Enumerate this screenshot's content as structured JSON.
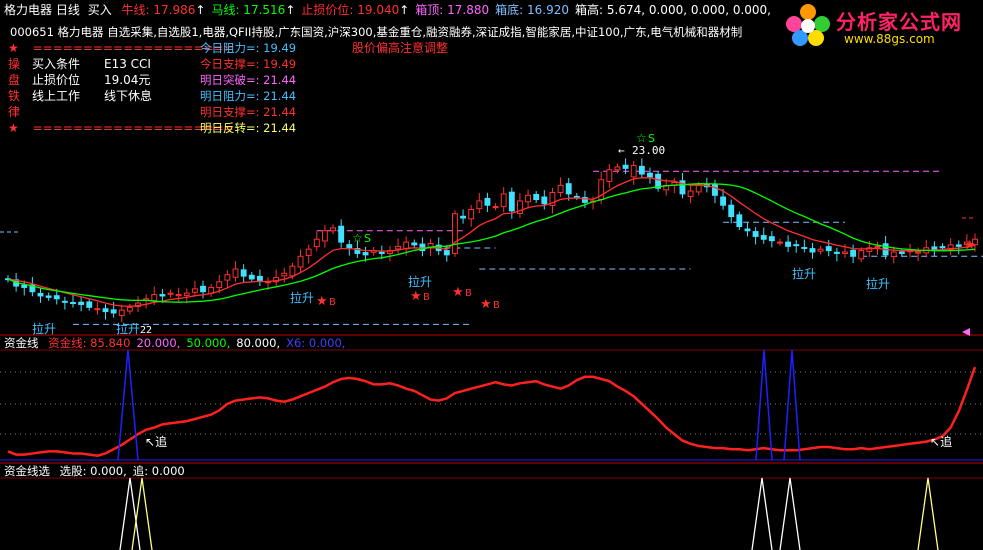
{
  "header": {
    "stock_name": "格力电器",
    "period": "日线",
    "buy_label": "买入",
    "items": [
      {
        "label": "牛线: 17.986",
        "color": "#ff3030"
      },
      {
        "label": "马线: 17.516",
        "color": "#00ff00"
      },
      {
        "label": "止损价位: 19.040",
        "color": "#ff3030"
      },
      {
        "label": "箱顶: 17.880",
        "color": "#ff66ff"
      },
      {
        "label": "箱底: 16.920",
        "color": "#80c0ff"
      },
      {
        "label": "箱高: 5.674, 0.000, 0.000, 0.000,",
        "color": "#ffffff"
      }
    ],
    "info_line": "000651 格力电器 自选采集,自选股1,电器,QFII持股,广东国资,沪深300,基金重仓,融资融券,深证成指,智能家居,中证100,广东,电气机械和器材制",
    "up_arrow": "↑"
  },
  "logo": {
    "title": "分析家公式网",
    "url": "www.88gs.com"
  },
  "rules_panel": {
    "star": "★",
    "separator": "====================",
    "side_chars": [
      "操",
      "盘",
      "铁",
      "律"
    ],
    "rows": [
      {
        "a": "买入条件",
        "b": "E13 CCI"
      },
      {
        "a": "止损价位",
        "b": "19.04元"
      },
      {
        "a": "线上工作",
        "b": "线下休息"
      }
    ]
  },
  "levels_panel": {
    "items": [
      {
        "label": "今日阻力=: 19.49",
        "color": "#40c0ff"
      },
      {
        "label": "今日支撑=: 19.49",
        "color": "#ff3030"
      },
      {
        "label": "明日突破=: 21.44",
        "color": "#ff66ff"
      },
      {
        "label": "明日阻力=: 21.44",
        "color": "#40c0ff"
      },
      {
        "label": "明日支撑=: 21.44",
        "color": "#ff3030"
      },
      {
        "label": "明日反转=: 21.44",
        "color": "#ffff66"
      }
    ]
  },
  "notice": "股价偏高注意调整",
  "annotations": {
    "peak_price": "23.00",
    "low_price": "22",
    "signal_s": "S",
    "signal_b": "B",
    "lift": "拉升",
    "chase": "追"
  },
  "money_panel": {
    "name": "资金线",
    "items": [
      {
        "label": "资金线: 85.840",
        "color": "#ff3030"
      },
      {
        "label": "20.000,",
        "color": "#ff66ff"
      },
      {
        "label": "50.000,",
        "color": "#00ff00"
      },
      {
        "label": "80.000,",
        "color": "#ffffff"
      },
      {
        "label": "X6: 0.000,",
        "color": "#4040ff"
      }
    ]
  },
  "select_panel": {
    "name": "资金线选",
    "items": [
      {
        "label": "选股: 0.000,",
        "color": "#ffffff"
      },
      {
        "label": "追: 0.000",
        "color": "#ffffff"
      }
    ]
  },
  "chart_data": {
    "type": "candlestick",
    "title": "格力电器 日线",
    "candles": {
      "count": 120,
      "close": [
        18.4,
        18.15,
        18.1,
        17.95,
        17.8,
        17.75,
        17.7,
        17.6,
        17.55,
        17.5,
        17.4,
        17.35,
        17.25,
        17.2,
        17.3,
        17.4,
        17.55,
        17.7,
        17.85,
        17.8,
        17.9,
        17.85,
        17.9,
        18.05,
        17.95,
        18.1,
        18.3,
        18.55,
        18.75,
        18.5,
        18.4,
        18.35,
        18.3,
        18.45,
        18.6,
        18.85,
        19.2,
        19.45,
        19.8,
        20.1,
        20.2,
        19.7,
        19.5,
        19.3,
        19.25,
        19.4,
        19.3,
        19.4,
        19.55,
        19.7,
        19.6,
        19.4,
        19.65,
        19.4,
        19.25,
        20.7,
        20.55,
        20.85,
        21.15,
        21.0,
        20.95,
        21.4,
        20.8,
        21.15,
        21.35,
        21.2,
        21.05,
        21.45,
        21.7,
        21.4,
        21.3,
        21.1,
        21.15,
        21.9,
        22.25,
        22.35,
        22.3,
        22.4,
        22.1,
        22.0,
        21.6,
        21.7,
        21.8,
        21.4,
        21.5,
        21.7,
        21.65,
        21.35,
        21.0,
        20.6,
        20.25,
        20.1,
        19.9,
        19.8,
        19.75,
        19.7,
        19.55,
        19.6,
        19.5,
        19.35,
        19.45,
        19.4,
        19.3,
        19.35,
        19.2,
        19.4,
        19.5,
        19.55,
        19.25,
        19.35,
        19.3,
        19.4,
        19.35,
        19.5,
        19.45,
        19.5,
        19.6,
        19.55,
        19.7,
        19.8
      ],
      "up_color": "#ff3030",
      "down_color": "#40e0ff"
    },
    "series": [
      {
        "name": "牛线",
        "color": "#ff3030"
      },
      {
        "name": "马线",
        "color": "#00ff00"
      }
    ],
    "levels": [
      {
        "name": "箱顶",
        "value": 21.44,
        "color": "#ff66ff"
      },
      {
        "name": "箱底",
        "value": 19.49,
        "color": "#80c0ff"
      }
    ],
    "money_line": [
      8,
      5,
      5,
      6,
      7,
      8,
      8,
      7,
      6,
      6,
      5,
      4,
      6,
      10,
      14,
      19,
      24,
      28,
      30,
      33,
      34,
      35,
      36,
      38,
      40,
      42,
      46,
      52,
      55,
      56,
      57,
      58,
      57,
      55,
      54,
      56,
      59,
      62,
      65,
      68,
      72,
      75,
      76,
      75,
      73,
      70,
      70,
      71,
      69,
      66,
      64,
      60,
      56,
      55,
      57,
      62,
      64,
      66,
      68,
      70,
      72,
      70,
      69,
      71,
      72,
      73,
      70,
      68,
      66,
      69,
      74,
      77,
      77,
      75,
      73,
      68,
      64,
      59,
      52,
      45,
      38,
      30,
      24,
      18,
      15,
      13,
      12,
      11,
      11,
      10,
      10,
      9,
      10,
      11,
      10,
      9,
      9,
      9,
      10,
      11,
      12,
      12,
      11,
      10,
      10,
      11,
      10,
      11,
      12,
      13,
      14,
      15,
      16,
      17,
      19,
      22,
      30,
      45,
      65,
      86
    ],
    "select_signals": [
      16,
      17,
      95,
      97,
      117
    ]
  }
}
